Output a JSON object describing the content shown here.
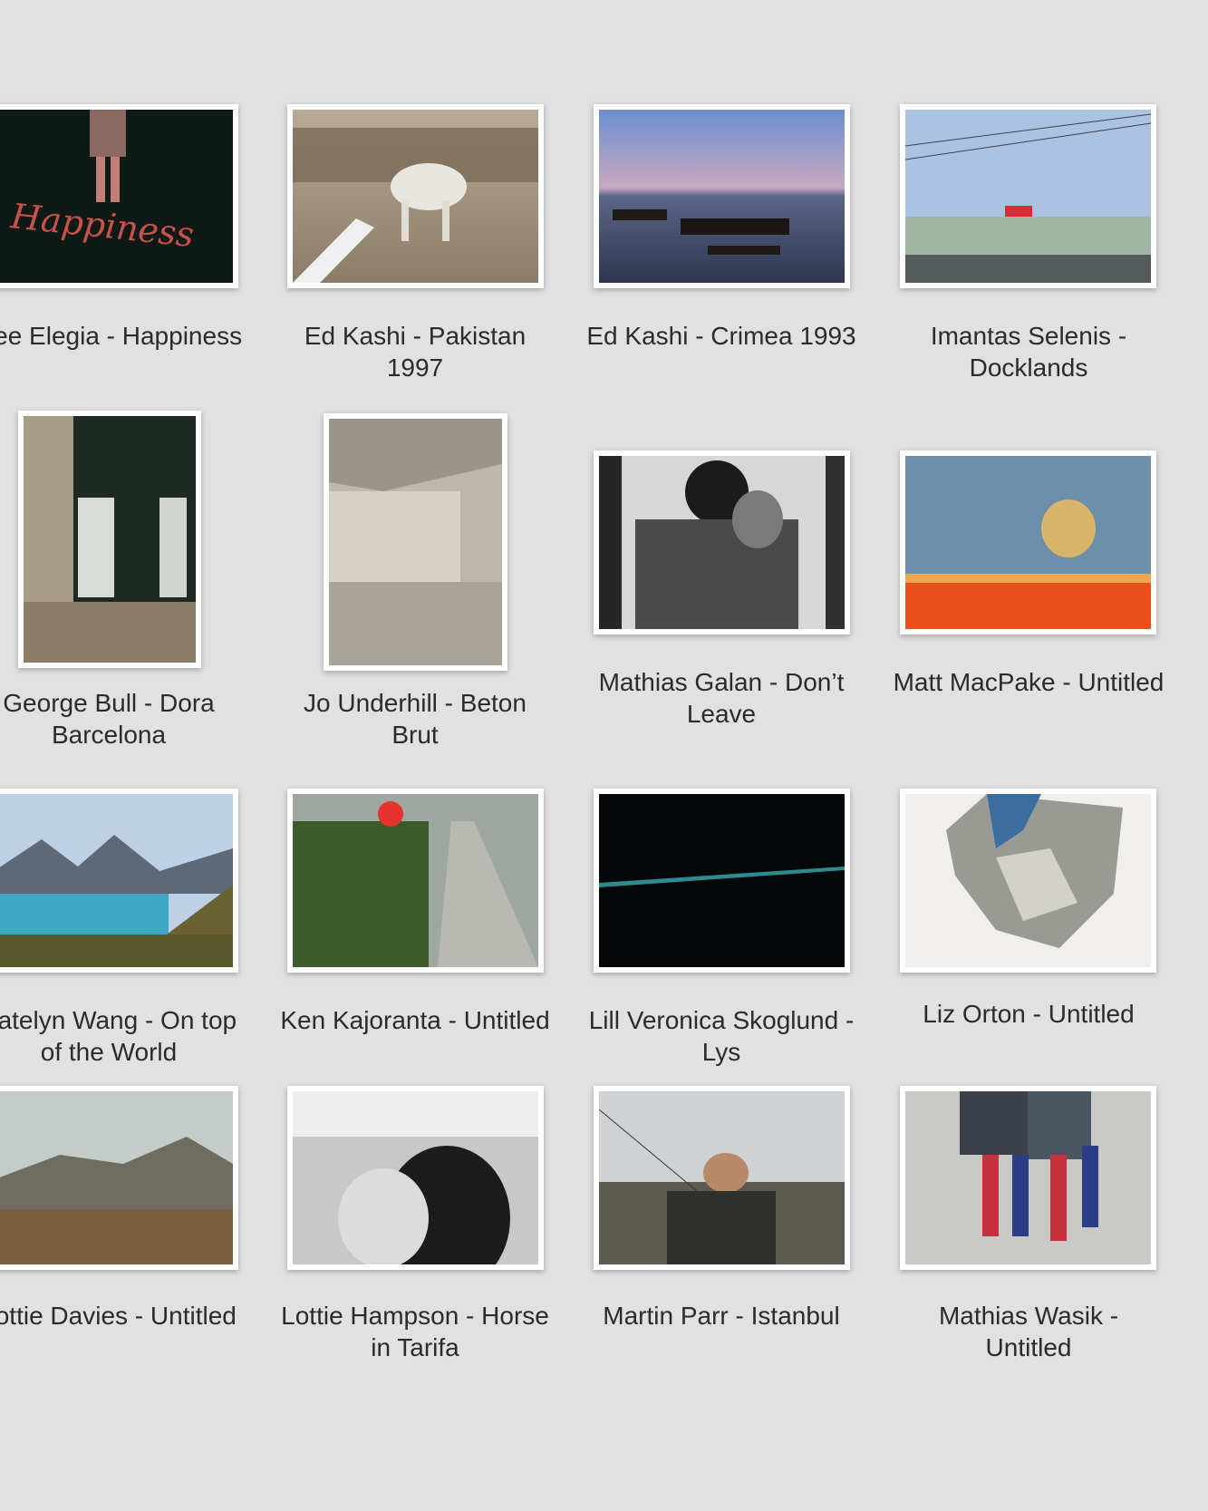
{
  "gallery": {
    "items": [
      {
        "title": "Dee Elegia - Happiness",
        "subject": "woman-happiness-street-photo"
      },
      {
        "title": "Ed Kashi - Pakistan 1997",
        "subject": "horse-crowd-photo"
      },
      {
        "title": "Ed Kashi - Crimea 1993",
        "subject": "sea-dusk-photo"
      },
      {
        "title": "Imantas Selenis - Docklands",
        "subject": "docklands-road-photo"
      },
      {
        "title": "George Bull - Dora Barcelona",
        "subject": "storefront-photo"
      },
      {
        "title": "Jo Underhill - Beton Brut",
        "subject": "concrete-architecture-photo"
      },
      {
        "title": "Mathias Galan - Don’t Leave",
        "subject": "embrace-bw-photo"
      },
      {
        "title": "Matt MacPake - Untitled",
        "subject": "bus-window-photo"
      },
      {
        "title": "Katelyn Wang - On top of the World",
        "subject": "mountain-lake-photo"
      },
      {
        "title": "Ken Kajoranta - Untitled",
        "subject": "red-balloon-path-photo"
      },
      {
        "title": "Lill Veronica Skoglund - Lys",
        "subject": "light-streak-photo"
      },
      {
        "title": "Liz Orton - Untitled",
        "subject": "crumpled-print-photo"
      },
      {
        "title": "Lottie Davies - Untitled",
        "subject": "highland-landscape-photo"
      },
      {
        "title": "Lottie Hampson - Horse in Tarifa",
        "subject": "horse-bw-photo"
      },
      {
        "title": "Martin Parr - Istanbul",
        "subject": "fisherman-photo"
      },
      {
        "title": "Mathias Wasik - Untitled",
        "subject": "flag-leggings-photo"
      }
    ]
  }
}
